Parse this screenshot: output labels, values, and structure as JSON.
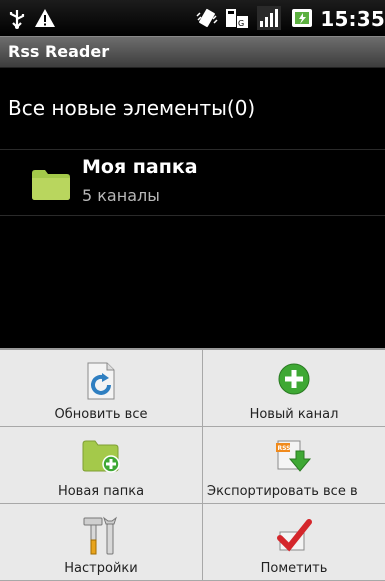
{
  "status_bar": {
    "time": "15:35"
  },
  "app": {
    "title": "Rss Reader"
  },
  "list": {
    "all_new": "Все новые элементы(0)",
    "folder": {
      "name": "Моя папка",
      "count": "5 каналы"
    }
  },
  "menu": {
    "items": [
      {
        "label": "Обновить все",
        "icon": "refresh-icon"
      },
      {
        "label": "Новый канал",
        "icon": "add-channel-icon"
      },
      {
        "label": "Новая папка",
        "icon": "new-folder-icon"
      },
      {
        "label": "Экспортировать все в",
        "icon": "export-icon"
      },
      {
        "label": "Настройки",
        "icon": "settings-icon"
      },
      {
        "label": "Пометить",
        "icon": "mark-icon"
      }
    ]
  },
  "colors": {
    "folder": "#a4c94a",
    "menu_bg": "#e9e9e9",
    "accent_green": "#3ea834",
    "check_red": "#d4262b"
  }
}
